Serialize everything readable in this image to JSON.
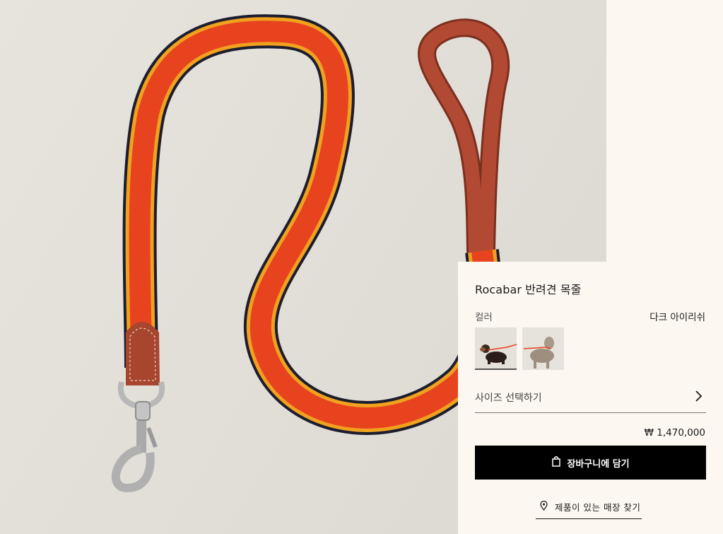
{
  "product": {
    "title": "Rocabar 반려견 목줄",
    "image_alt": "leash-product-photo"
  },
  "color": {
    "label": "컬러",
    "selected": "다크 아이리쉬",
    "swatches": [
      {
        "name": "dachshund-swatch",
        "selected": true
      },
      {
        "name": "weimaraner-swatch",
        "selected": false
      }
    ]
  },
  "size": {
    "label": "사이즈 선택하기",
    "icon": "chevron-right-icon"
  },
  "price": "₩ 1,470,000",
  "cart": {
    "label": "장바구니에 담기",
    "icon": "shopping-bag-icon"
  },
  "store": {
    "label": "제품이 있는 매장 찾기",
    "icon": "location-pin-icon"
  },
  "colors": {
    "background": "#fcf7f1",
    "button": "#000000",
    "leash_red": "#e8431f",
    "leash_orange": "#f0a21f",
    "leash_navy": "#1c1d2e",
    "leather": "#a8452e"
  }
}
